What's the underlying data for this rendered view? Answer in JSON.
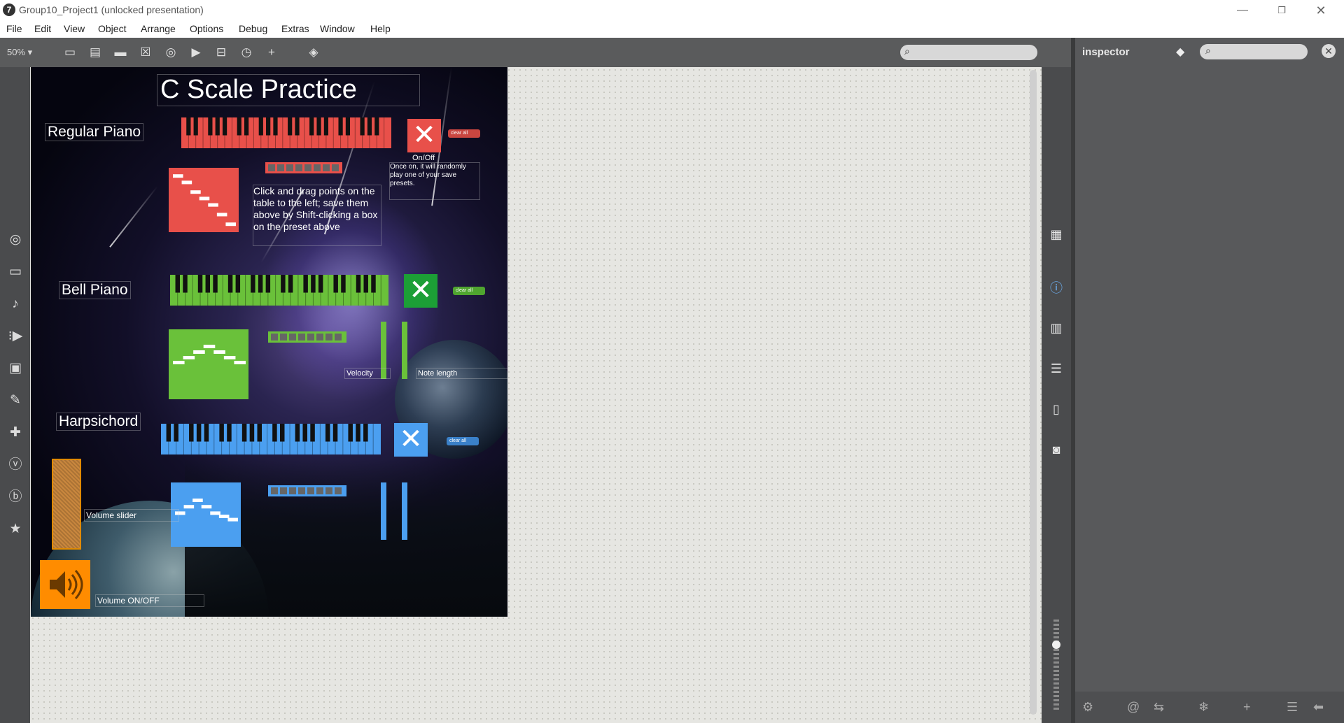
{
  "window": {
    "title": "Group10_Project1 (unlocked presentation)",
    "app_icon": "7"
  },
  "menu": [
    "File",
    "Edit",
    "View",
    "Object",
    "Arrange",
    "Options",
    "Debug",
    "Extras",
    "Window",
    "Help"
  ],
  "toolbar": {
    "zoom": "50% ▾"
  },
  "inspector": {
    "title": "inspector"
  },
  "patch": {
    "title": "C Scale Practice",
    "instruments": [
      {
        "name": "Regular Piano",
        "color": "#e8504a",
        "clear_label": "clear all"
      },
      {
        "name": "Bell Piano",
        "color": "#6ac13a",
        "clear_label": "clear all"
      },
      {
        "name": "Harpsichord",
        "color": "#4b9ff0",
        "clear_label": "clear all"
      }
    ],
    "onoff_label": "On/Off",
    "onoff_note": "Once on, it will randomly play one of your save presets.",
    "instructions": "Click and drag points on the table to the left; save them above by Shift-clicking a box on the preset above",
    "velocity_label": "Velocity",
    "note_length_label": "Note length",
    "volume_slider_label": "Volume slider",
    "volume_toggle_label": "Volume ON/OFF",
    "accent_orange": "#ff8c00"
  }
}
